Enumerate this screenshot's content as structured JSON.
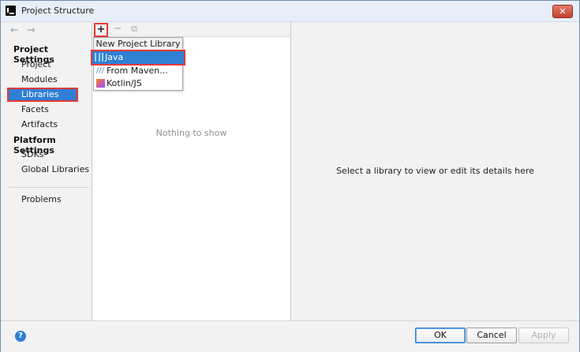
{
  "window": {
    "title": "Project Structure",
    "close_label": "✕"
  },
  "nav": {
    "back": "←",
    "forward": "→"
  },
  "sidebar": {
    "project_settings_heading": "Project Settings",
    "project_settings_items": [
      {
        "label": "Project"
      },
      {
        "label": "Modules"
      },
      {
        "label": "Libraries",
        "selected": true
      },
      {
        "label": "Facets"
      },
      {
        "label": "Artifacts"
      }
    ],
    "platform_settings_heading": "Platform Settings",
    "platform_settings_items": [
      {
        "label": "SDKs"
      },
      {
        "label": "Global Libraries"
      }
    ],
    "problems_label": "Problems"
  },
  "list_pane": {
    "toolbar": {
      "add": "+",
      "remove": "−",
      "copy": "⧉"
    },
    "empty_text": "Nothing to show"
  },
  "dropdown": {
    "title": "New Project Library",
    "items": [
      {
        "label": "Java",
        "icon": "java-library-icon",
        "active": true
      },
      {
        "label": "From Maven...",
        "icon": "maven-icon"
      },
      {
        "label": "Kotlin/JS",
        "icon": "kotlin-js-icon"
      }
    ]
  },
  "detail_pane": {
    "message": "Select a library to view or edit its details here"
  },
  "footer": {
    "help": "?",
    "ok": "OK",
    "cancel": "Cancel",
    "apply": "Apply"
  },
  "colors": {
    "accent": "#2f7fd4",
    "highlight": "#e53935"
  }
}
